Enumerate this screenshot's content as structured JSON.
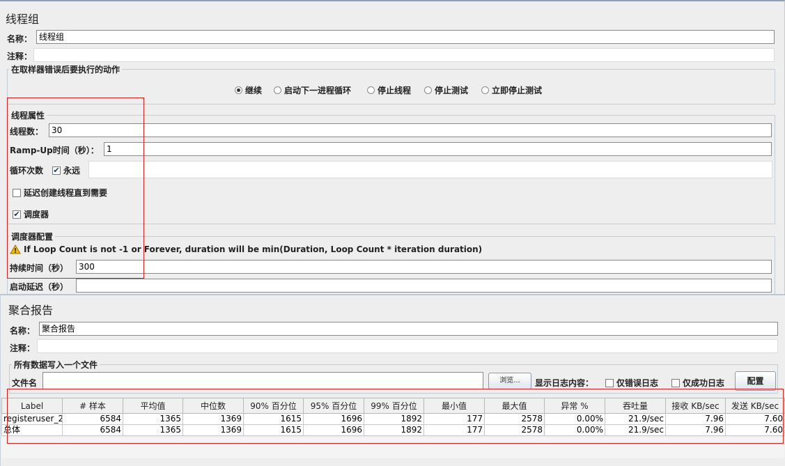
{
  "thread_group": {
    "title": "线程组",
    "name_label": "名称：",
    "name_value": "线程组",
    "comment_label": "注释：",
    "comment_value": "",
    "sampler_error": {
      "legend": "在取样器错误后要执行的动作",
      "options": [
        "继续",
        "启动下一进程循环",
        "停止线程",
        "停止测试",
        "立即停止测试"
      ],
      "selected": "继续"
    },
    "thread_props": {
      "legend": "线程属性",
      "threads_label": "线程数：",
      "threads_value": "30",
      "rampup_label": "Ramp-Up时间（秒）：",
      "rampup_value": "1",
      "loop_label": "循环次数",
      "forever_label": "永远",
      "forever_checked": true,
      "loop_value": "",
      "delay_label": "延迟创建线程直到需要",
      "delay_checked": false,
      "scheduler_label": "调度器",
      "scheduler_checked": true
    },
    "scheduler_config": {
      "legend": "调度器配置",
      "warning": "If Loop Count is not -1 or Forever, duration will be min(Duration, Loop Count * iteration duration)",
      "duration_label": "持续时间（秒）",
      "duration_value": "300",
      "startup_delay_label": "启动延迟（秒）",
      "startup_delay_value": ""
    }
  },
  "aggregate_report": {
    "title": "聚合报告",
    "name_label": "名称：",
    "name_value": "聚合报告",
    "comment_label": "注释：",
    "comment_value": "",
    "file_group": {
      "legend": "所有数据写入一个文件",
      "filename_label": "文件名",
      "filename_value": "",
      "browse_label": "浏览...",
      "log_content_label": "显示日志内容：",
      "errors_only_label": "仅错误日志",
      "success_only_label": "仅成功日志",
      "configure_label": "配置"
    },
    "table": {
      "columns": [
        "Label",
        "# 样本",
        "平均值",
        "中位数",
        "90% 百分位",
        "95% 百分位",
        "99% 百分位",
        "最小值",
        "最大值",
        "异常 %",
        "吞吐量",
        "接收 KB/sec",
        "发送 KB/sec"
      ],
      "rows": [
        [
          "registeruser_2",
          "6584",
          "1365",
          "1369",
          "1615",
          "1696",
          "1892",
          "177",
          "2578",
          "0.00%",
          "21.9/sec",
          "7.96",
          "7.60"
        ],
        [
          "总体",
          "6584",
          "1365",
          "1369",
          "1615",
          "1696",
          "1892",
          "177",
          "2578",
          "0.00%",
          "21.9/sec",
          "7.96",
          "7.60"
        ]
      ]
    }
  },
  "colors": {
    "highlight": "#d02020",
    "panel_bg": "#eeeeee",
    "warning": "#f0b000"
  }
}
